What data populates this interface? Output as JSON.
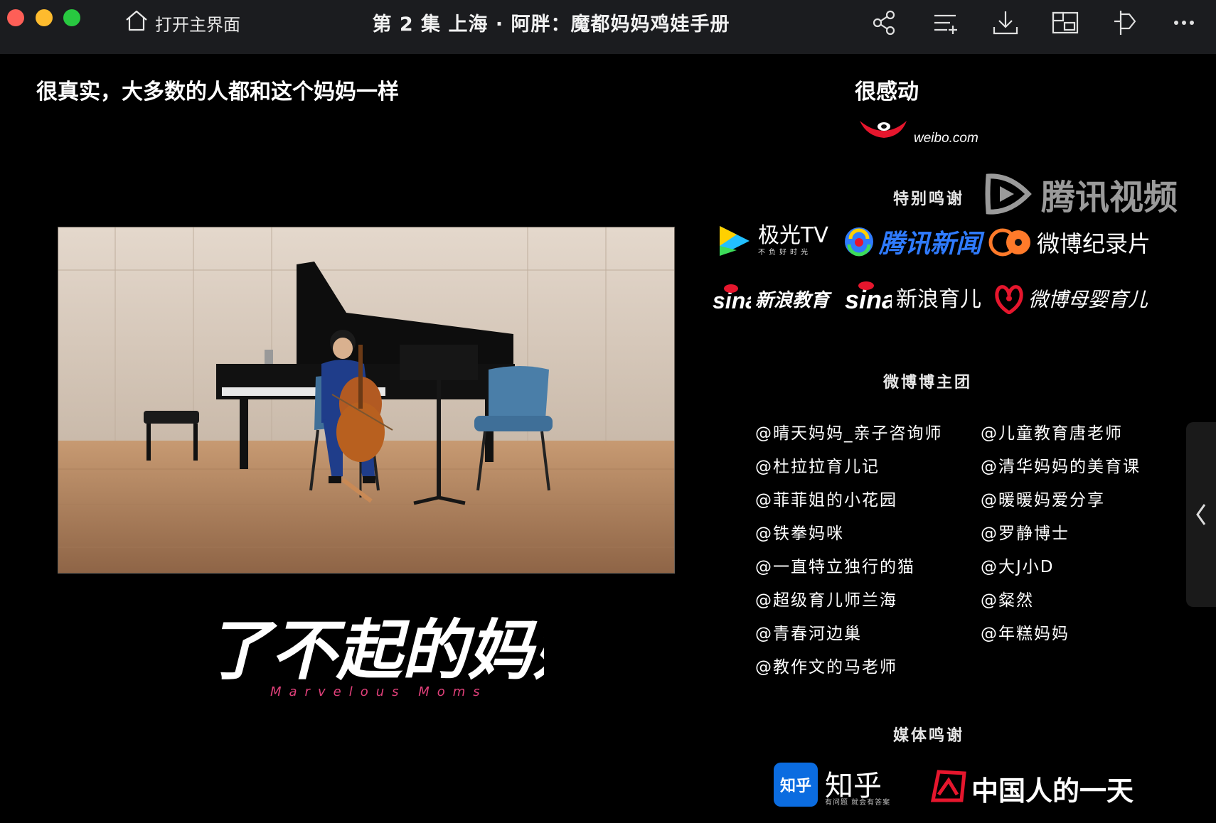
{
  "titlebar": {
    "home_label": "打开主界面",
    "title": "第 2 集 上海 · 阿胖：魔都妈妈鸡娃手册",
    "icons": [
      "share-icon",
      "playlist-icon",
      "download-icon",
      "picture-in-picture-icon",
      "pin-icon",
      "more-icon"
    ]
  },
  "comments": {
    "left": "很真实，大多数的人都和这个妈妈一样",
    "right": "很感动"
  },
  "show": {
    "title_cn": "了不起的妈妈",
    "title_en": "Marvelous Moms"
  },
  "credits": {
    "weibo_domain": "weibo.com",
    "special_thanks": "特别鸣谢",
    "tencent_video": "腾讯视频",
    "brands": [
      {
        "name": "极光TV",
        "sub": "不负好时光"
      },
      {
        "name": "腾讯新闻"
      },
      {
        "name": "微博纪录片"
      },
      {
        "name": "新浪教育"
      },
      {
        "name": "新浪育儿"
      },
      {
        "name": "微博母婴育儿"
      }
    ],
    "weibo_group": "微博博主团",
    "handles_left": [
      "@晴天妈妈_亲子咨询师",
      "@杜拉拉育儿记",
      "@菲菲姐的小花园",
      "@铁拳妈咪",
      "@一直特立独行的猫",
      "@超级育儿师兰海",
      "@青春河边巢",
      "@教作文的马老师"
    ],
    "handles_right": [
      "@儿童教育唐老师",
      "@清华妈妈的美育课",
      "@暖暖妈爱分享",
      "@罗静博士",
      "@大J小D",
      "@粲然",
      "@年糕妈妈"
    ],
    "media_thanks": "媒体鸣谢",
    "zhihu": {
      "box": "知乎",
      "name": "知乎",
      "sub": "有问题 就会有答案"
    },
    "cnday": "中国人的一天"
  },
  "colors": {
    "titlebar_bg": "#1b1c1f",
    "tencent_news_blue": "#2f7bff",
    "weibo_red": "#e6162d",
    "zhihu_blue": "#0b6ce0",
    "logo_pink": "#e0407a"
  }
}
